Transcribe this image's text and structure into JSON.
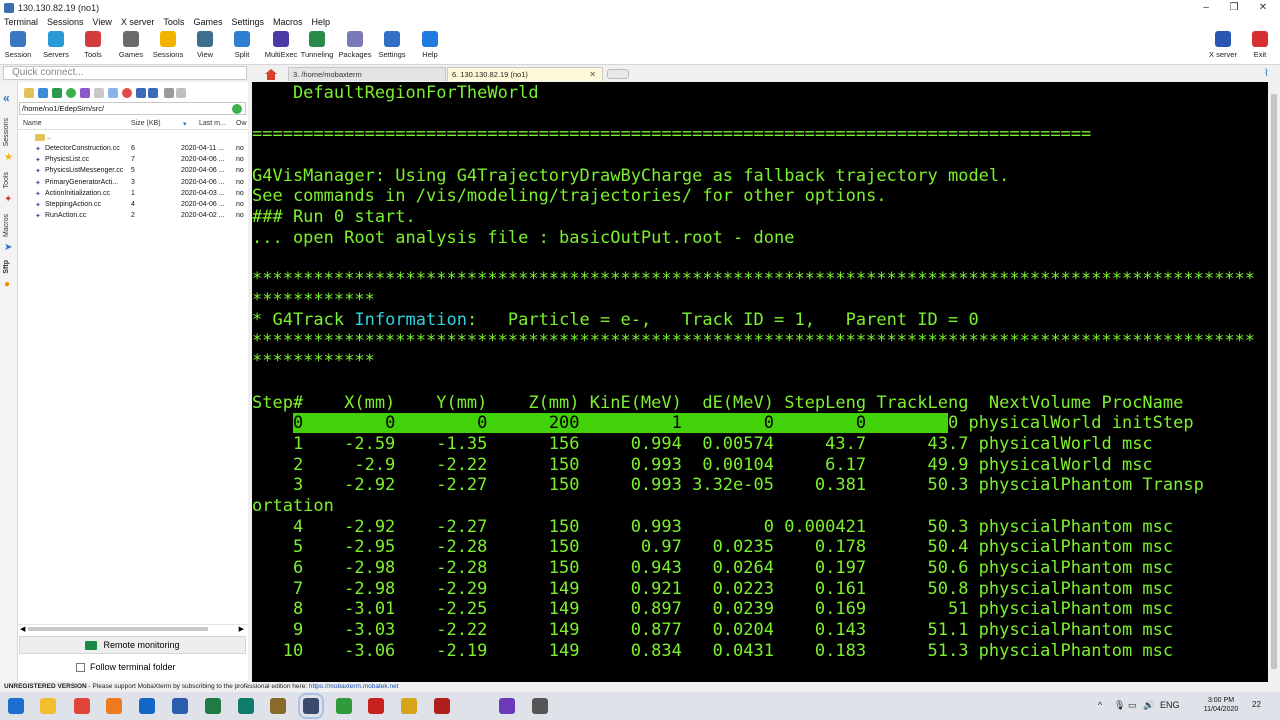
{
  "window": {
    "title": "130.130.82.19 (no1)",
    "controls": [
      "–",
      "❐",
      "✕"
    ]
  },
  "menu": [
    "Terminal",
    "Sessions",
    "View",
    "X server",
    "Tools",
    "Games",
    "Settings",
    "Macros",
    "Help"
  ],
  "toolbar": [
    {
      "label": "Session",
      "icon": "session-icon",
      "color": "#3a78c2"
    },
    {
      "label": "Servers",
      "icon": "servers-icon",
      "color": "#2a9ad6"
    },
    {
      "label": "Tools",
      "icon": "tools-icon",
      "color": "#d23c3c"
    },
    {
      "label": "Games",
      "icon": "games-icon",
      "color": "#6b6b6b"
    },
    {
      "label": "Sessions",
      "icon": "sessions-star-icon",
      "color": "#f2b400"
    },
    {
      "label": "View",
      "icon": "view-icon",
      "color": "#3d6e8e"
    },
    {
      "label": "Split",
      "icon": "split-icon",
      "color": "#2f7fd1"
    },
    {
      "label": "MultiExec",
      "icon": "multiexec-icon",
      "color": "#4a3aa8"
    },
    {
      "label": "Tunneling",
      "icon": "tunneling-icon",
      "color": "#2a8a4a"
    },
    {
      "label": "Packages",
      "icon": "packages-icon",
      "color": "#7a7ab8"
    },
    {
      "label": "Settings",
      "icon": "settings-gear-icon",
      "color": "#2f6fc4"
    },
    {
      "label": "Help",
      "icon": "help-icon",
      "color": "#1f7be0"
    }
  ],
  "toolbar_right": [
    {
      "label": "X server",
      "icon": "x-server-icon",
      "color": "#2b56b0"
    },
    {
      "label": "Exit",
      "icon": "power-icon",
      "color": "#d83030"
    }
  ],
  "quick_connect": {
    "placeholder": "Quick connect..."
  },
  "tabs": [
    {
      "label": "3. /home/mobaxterm",
      "active": false
    },
    {
      "label": "6. 130.130.82.19 (no1)",
      "active": true
    }
  ],
  "side_labels": [
    "Sessions",
    "Tools",
    "Macros",
    "Sftp"
  ],
  "sftp": {
    "path": "/home/no1/EdepSim/src/",
    "columns": [
      "Name",
      "Size (KB)",
      "Last m...",
      "Ow"
    ],
    "parent": "..",
    "files": [
      {
        "name": "DetectorConstruction.cc",
        "size": "6",
        "date": "2020-04-11 ...",
        "owner": "no"
      },
      {
        "name": "PhysicsList.cc",
        "size": "7",
        "date": "2020-04-06 ...",
        "owner": "no"
      },
      {
        "name": "PhysicsListMessenger.cc",
        "size": "5",
        "date": "2020-04-06 ...",
        "owner": "no"
      },
      {
        "name": "PrimaryGeneratorActi...",
        "size": "3",
        "date": "2020-04-06 ...",
        "owner": "no"
      },
      {
        "name": "ActionInitialization.cc",
        "size": "1",
        "date": "2020-04-03 ...",
        "owner": "no"
      },
      {
        "name": "SteppingAction.cc",
        "size": "4",
        "date": "2020-04-06 ...",
        "owner": "no"
      },
      {
        "name": "RunAction.cc",
        "size": "2",
        "date": "2020-04-02 ...",
        "owner": "no"
      }
    ],
    "remote_monitoring": "Remote monitoring",
    "follow_folder": "Follow terminal folder"
  },
  "terminal": {
    "lines": [
      {
        "text": "    DefaultRegionForTheWorld"
      },
      {
        "text": ""
      },
      {
        "text": "=================================================================================="
      },
      {
        "text": ""
      },
      {
        "text": "G4VisManager: Using G4TrajectoryDrawByCharge as fallback trajectory model."
      },
      {
        "text": "See commands in /vis/modeling/trajectories/ for other options."
      },
      {
        "text": "### Run 0 start."
      },
      {
        "text": "... open Root analysis file : basicOutPut.root - done"
      },
      {
        "text": ""
      },
      {
        "text": "**************************************************************************************************"
      },
      {
        "text": "************"
      },
      {
        "pre": "* G4Track ",
        "cyan": "Information",
        "post": ":   Particle = e-,   Track ID = 1,   Parent ID = 0"
      },
      {
        "text": "**************************************************************************************************"
      },
      {
        "text": "************"
      },
      {
        "text": ""
      },
      {
        "text": "Step#    X(mm)    Y(mm)    Z(mm) KinE(MeV)  dE(MeV) StepLeng TrackLeng  NextVolume ProcName"
      },
      {
        "hlpre": "    ",
        "hl": "0        0        0      200         1        0        0        ",
        "hlpost": "0 physicalWorld initStep"
      },
      {
        "text": "    1    -2.59    -1.35      156     0.994  0.00574     43.7      43.7 physicalWorld msc"
      },
      {
        "text": "    2     -2.9    -2.22      150     0.993  0.00104     6.17      49.9 physicalWorld msc"
      },
      {
        "text": "    3    -2.92    -2.27      150     0.993 3.32e-05    0.381      50.3 physcialPhantom Transp"
      },
      {
        "text": "ortation"
      },
      {
        "text": "    4    -2.92    -2.27      150     0.993        0 0.000421      50.3 physcialPhantom msc"
      },
      {
        "text": "    5    -2.95    -2.28      150      0.97   0.0235    0.178      50.4 physcialPhantom msc"
      },
      {
        "text": "    6    -2.98    -2.28      150     0.943   0.0264    0.197      50.6 physcialPhantom msc"
      },
      {
        "text": "    7    -2.98    -2.29      149     0.921   0.0223    0.161      50.8 physcialPhantom msc"
      },
      {
        "text": "    8    -3.01    -2.25      149     0.897   0.0239    0.169        51 physcialPhantom msc"
      },
      {
        "text": "    9    -3.03    -2.22      149     0.877   0.0204    0.143      51.1 physcialPhantom msc"
      },
      {
        "text": "   10    -3.06    -2.19      149     0.834   0.0431    0.183      51.3 physcialPhantom msc"
      }
    ]
  },
  "status": {
    "unregistered": "UNREGISTERED VERSION",
    "message": " -  Please support MobaXterm by subscribing to the professional edition here:  ",
    "link": "https://mobaxterm.mobatek.net"
  },
  "taskbar": {
    "apps": [
      {
        "icon": "windows-start-icon",
        "color": "#1b6fd0"
      },
      {
        "icon": "file-explorer-icon",
        "color": "#f0c02e"
      },
      {
        "icon": "chrome-icon",
        "color": "#e0433a"
      },
      {
        "icon": "firefox-icon",
        "color": "#f07a1e"
      },
      {
        "icon": "outlook-icon",
        "color": "#1366c4"
      },
      {
        "icon": "word-icon",
        "color": "#2b5cad"
      },
      {
        "icon": "excel-icon",
        "color": "#1f7a44"
      },
      {
        "icon": "publisher-icon",
        "color": "#0e7c6b"
      },
      {
        "icon": "app-icon",
        "color": "#8a6a2a"
      },
      {
        "icon": "mobaxterm-icon",
        "color": "#3a4a6a",
        "active": true
      },
      {
        "icon": "tree-app-icon",
        "color": "#2f9a3a"
      },
      {
        "icon": "acrobat-icon",
        "color": "#c8221e"
      },
      {
        "icon": "puzzle-app-icon",
        "color": "#d6a418"
      },
      {
        "icon": "pdf-icon",
        "color": "#b01e1e"
      },
      {
        "icon": "visual-studio-icon",
        "color": "#6a3ab8"
      },
      {
        "icon": "clock-app-icon",
        "color": "#555555"
      }
    ],
    "tray": [
      "^",
      "ENG"
    ],
    "time": "3:00 PM",
    "date": "11/04/2020",
    "notifications": "22"
  }
}
